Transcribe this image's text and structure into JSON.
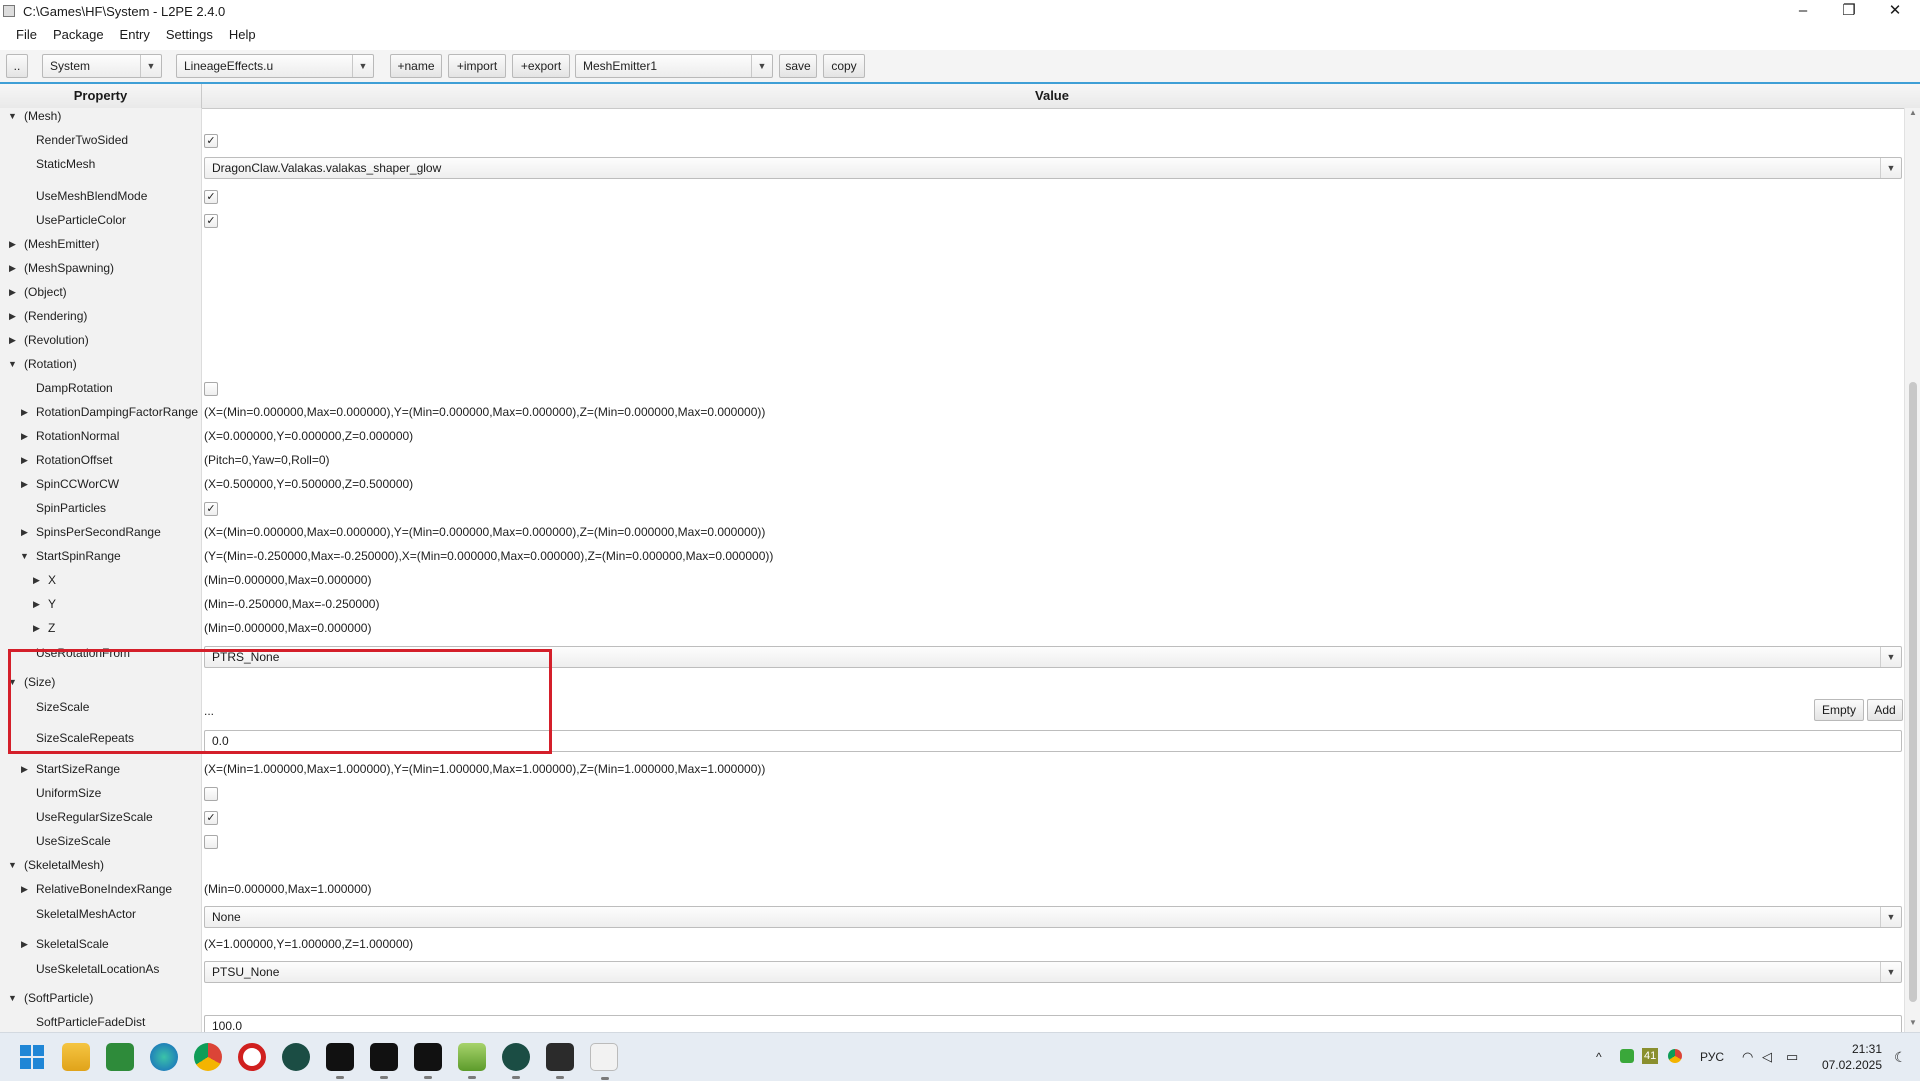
{
  "window": {
    "title": "C:\\Games\\HF\\System - L2PE 2.4.0",
    "minimize_glyph": "–",
    "maximize_glyph": "❐",
    "close_glyph": "✕"
  },
  "menu": [
    "File",
    "Package",
    "Entry",
    "Settings",
    "Help"
  ],
  "toolbar": {
    "dots_label": "..",
    "folder_value": "System",
    "package_value": "LineageEffects.u",
    "name_label": "+name",
    "import_label": "+import",
    "export_label": "+export",
    "entry_value": "MeshEmitter1",
    "save_label": "save",
    "copy_label": "copy"
  },
  "table": {
    "col_property": "Property",
    "col_value": "Value"
  },
  "rows": {
    "mesh": "(Mesh)",
    "render_two_sided": "RenderTwoSided",
    "static_mesh": "StaticMesh",
    "static_mesh_value": "DragonClaw.Valakas.valakas_shaper_glow",
    "use_mesh_blend_mode": "UseMeshBlendMode",
    "use_particle_color": "UseParticleColor",
    "mesh_emitter": "(MeshEmitter)",
    "mesh_spawning": "(MeshSpawning)",
    "object": "(Object)",
    "rendering": "(Rendering)",
    "revolution": "(Revolution)",
    "rotation": "(Rotation)",
    "damp_rotation": "DampRotation",
    "rotation_damping": "RotationDampingFactorRange",
    "rotation_damping_value": "(X=(Min=0.000000,Max=0.000000),Y=(Min=0.000000,Max=0.000000),Z=(Min=0.000000,Max=0.000000))",
    "rotation_normal": "RotationNormal",
    "rotation_normal_value": "(X=0.000000,Y=0.000000,Z=0.000000)",
    "rotation_offset": "RotationOffset",
    "rotation_offset_value": "(Pitch=0,Yaw=0,Roll=0)",
    "spin_cc_or_cw": "SpinCCWorCW",
    "spin_cc_or_cw_value": "(X=0.500000,Y=0.500000,Z=0.500000)",
    "spin_particles": "SpinParticles",
    "spins_per_second": "SpinsPerSecondRange",
    "spins_per_second_value": "(X=(Min=0.000000,Max=0.000000),Y=(Min=0.000000,Max=0.000000),Z=(Min=0.000000,Max=0.000000))",
    "start_spin_range": "StartSpinRange",
    "start_spin_range_value": "(Y=(Min=-0.250000,Max=-0.250000),X=(Min=0.000000,Max=0.000000),Z=(Min=0.000000,Max=0.000000))",
    "spin_x": "X",
    "spin_x_value": "(Min=0.000000,Max=0.000000)",
    "spin_y": "Y",
    "spin_y_value": "(Min=-0.250000,Max=-0.250000)",
    "spin_z": "Z",
    "spin_z_value": "(Min=0.000000,Max=0.000000)",
    "use_rotation_from": "UseRotationFrom",
    "use_rotation_from_value": "PTRS_None",
    "size": "(Size)",
    "size_scale": "SizeScale",
    "size_scale_value": "...",
    "empty_label": "Empty",
    "add_label": "Add",
    "size_scale_repeats": "SizeScaleRepeats",
    "size_scale_repeats_value": "0.0",
    "start_size_range": "StartSizeRange",
    "start_size_range_value": "(X=(Min=1.000000,Max=1.000000),Y=(Min=1.000000,Max=1.000000),Z=(Min=1.000000,Max=1.000000))",
    "uniform_size": "UniformSize",
    "use_regular_size_scale": "UseRegularSizeScale",
    "use_size_scale": "UseSizeScale",
    "skeletal_mesh": "(SkeletalMesh)",
    "relative_bone": "RelativeBoneIndexRange",
    "relative_bone_value": "(Min=0.000000,Max=1.000000)",
    "skeletal_mesh_actor": "SkeletalMeshActor",
    "skeletal_mesh_actor_value": "None",
    "skeletal_scale": "SkeletalScale",
    "skeletal_scale_value": "(X=1.000000,Y=1.000000,Z=1.000000)",
    "use_skeletal_location_as": "UseSkeletalLocationAs",
    "use_skeletal_location_as_value": "PTSU_None",
    "soft_particle": "(SoftParticle)",
    "soft_particle_fade_dist": "SoftParticleFadeDist",
    "soft_particle_fade_dist_value": "100.0"
  },
  "checkboxes": {
    "render_two_sided": true,
    "use_mesh_blend_mode": true,
    "use_particle_color": true,
    "damp_rotation": false,
    "spin_particles": true,
    "uniform_size": false,
    "use_regular_size_scale": true,
    "use_size_scale": false
  },
  "check_glyph": "✓",
  "colors": {
    "accent": "#3f9fd6",
    "highlight": "#d41f2a"
  },
  "taskbar": {
    "icons": [
      "windows-start",
      "file-explorer",
      "green-app",
      "edge",
      "chrome",
      "opera",
      "unreal-u",
      "terminal-dark-1",
      "terminal-dark-2",
      "terminal-dark-3",
      "notepad",
      "unreal-u-2",
      "console",
      "l2pe-app"
    ],
    "tray_language": "РУС",
    "tray_badge": "41",
    "time": "21:31",
    "date": "07.02.2025"
  }
}
